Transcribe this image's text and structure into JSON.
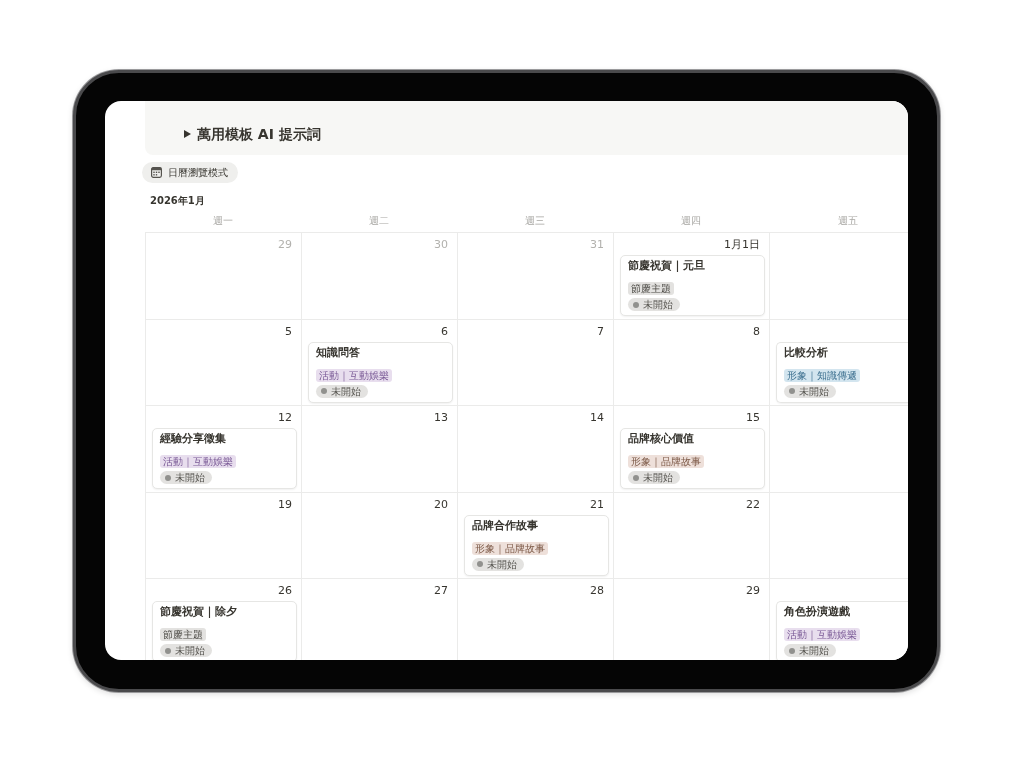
{
  "header": {
    "title": "萬用模板 AI 提示詞",
    "expanded": false
  },
  "view_button": {
    "label": "日曆瀏覽模式"
  },
  "calendar": {
    "month": "2026年1月",
    "weekdays": [
      "週一",
      "週二",
      "週三",
      "週四",
      "週五"
    ],
    "weeks": [
      {
        "days": [
          {
            "date": "29",
            "other_month": true
          },
          {
            "date": "30",
            "other_month": true
          },
          {
            "date": "31",
            "other_month": true
          },
          {
            "date": "1月1日",
            "other_month": false,
            "events": [
              {
                "title": "節慶祝賀｜元旦",
                "tag": {
                  "label": "節慶主題",
                  "color": "#e3e2e0"
                },
                "status": "未開始"
              }
            ]
          }
        ]
      },
      {
        "days": [
          {
            "date": "5",
            "other_month": false
          },
          {
            "date": "6",
            "other_month": false,
            "events": [
              {
                "title": "知識問答",
                "tag": {
                  "label": "活動｜互動娛樂",
                  "color": "#e8deee"
                },
                "status": "未開始"
              }
            ]
          },
          {
            "date": "7",
            "other_month": false
          },
          {
            "date": "8",
            "other_month": false
          },
          {
            "events": [
              {
                "title": "比較分析",
                "tag": {
                  "label": "形象｜知識傳遞",
                  "color": "#d3e5ef"
                },
                "status": "未開始"
              }
            ]
          }
        ]
      },
      {
        "days": [
          {
            "date": "12",
            "other_month": false,
            "events": [
              {
                "title": "經驗分享徵集",
                "tag": {
                  "label": "活動｜互動娛樂",
                  "color": "#e8deee"
                },
                "status": "未開始"
              }
            ]
          },
          {
            "date": "13",
            "other_month": false
          },
          {
            "date": "14",
            "other_month": false
          },
          {
            "date": "15",
            "other_month": false,
            "events": [
              {
                "title": "品牌核心價值",
                "tag": {
                  "label": "形象｜品牌故事",
                  "color": "#eee0da"
                },
                "status": "未開始"
              }
            ]
          }
        ]
      },
      {
        "days": [
          {
            "date": "19",
            "other_month": false
          },
          {
            "date": "20",
            "other_month": false
          },
          {
            "date": "21",
            "other_month": false,
            "events": [
              {
                "title": "品牌合作故事",
                "tag": {
                  "label": "形象｜品牌故事",
                  "color": "#eee0da"
                },
                "status": "未開始"
              }
            ]
          },
          {
            "date": "22",
            "other_month": false
          }
        ]
      },
      {
        "days": [
          {
            "date": "26",
            "other_month": false,
            "events": [
              {
                "title": "節慶祝賀｜除夕",
                "tag": {
                  "label": "節慶主題",
                  "color": "#e3e2e0"
                },
                "status": "未開始"
              }
            ]
          },
          {
            "date": "27",
            "other_month": false
          },
          {
            "date": "28",
            "other_month": false
          },
          {
            "date": "29",
            "other_month": false
          },
          {
            "events": [
              {
                "title": "角色扮演遊戲",
                "tag": {
                  "label": "活動｜互動娛樂",
                  "color": "#e8deee"
                },
                "status": "未開始"
              }
            ]
          }
        ]
      }
    ]
  }
}
